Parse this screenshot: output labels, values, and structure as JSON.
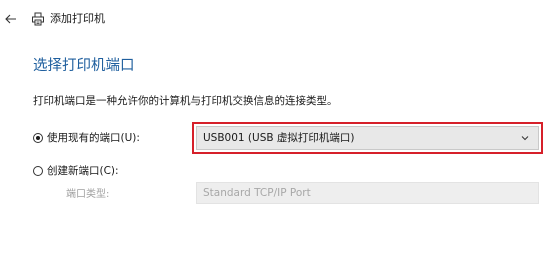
{
  "window": {
    "title": "添加打印机"
  },
  "page": {
    "heading": "选择打印机端口",
    "description": "打印机端口是一种允许你的计算机与打印机交换信息的连接类型。"
  },
  "options": {
    "use_existing": {
      "label": "使用现有的端口(U):",
      "checked": true,
      "selected_port": "USB001 (USB 虚拟打印机端口)"
    },
    "create_new": {
      "label": "创建新端口(C):",
      "checked": false,
      "port_type_label": "端口类型:",
      "port_type_value": "Standard TCP/IP Port"
    }
  },
  "colors": {
    "heading": "#1f5f9e",
    "highlight_border": "#d6202a",
    "disabled_text": "#a8a8a8"
  },
  "icons": {
    "back": "back-arrow-icon",
    "printer": "printer-icon",
    "dropdown": "chevron-down-icon"
  }
}
